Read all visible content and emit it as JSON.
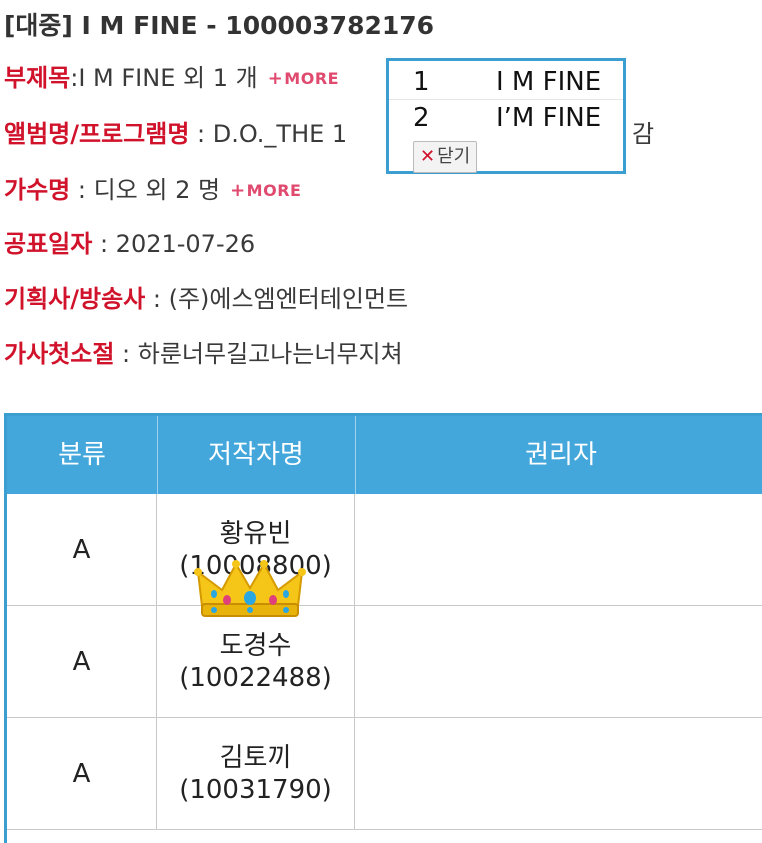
{
  "header": {
    "title": "[대중] I M FINE - 100003782176"
  },
  "info": {
    "subtitle": {
      "label": "부제목",
      "value": ":I M FINE 외 1 개",
      "more": "MORE"
    },
    "album": {
      "label": "앨범명/프로그램명",
      "value": " : D.O._THE 1",
      "tail": "감"
    },
    "artist": {
      "label": "가수명",
      "value": " : 디오 외 2 명",
      "more": "MORE"
    },
    "release_date": {
      "label": "공표일자",
      "value": " : 2021-07-26"
    },
    "company": {
      "label": "기획사/방송사",
      "value": " : (주)에스엠엔터테인먼트"
    },
    "first_lyric": {
      "label": "가사첫소절",
      "value": " : 하룬너무길고나는너무지쳐"
    }
  },
  "popup": {
    "items": [
      {
        "num": "1",
        "name": "I M FINE"
      },
      {
        "num": "2",
        "name": "I’M FINE"
      }
    ],
    "close_x": "✕",
    "close_label": "닫기"
  },
  "table": {
    "headers": [
      "분류",
      "저작자명",
      "권리자"
    ],
    "rows": [
      {
        "category": "A",
        "author": "황유빈(10008800)",
        "holder": ""
      },
      {
        "category": "A",
        "author": "도경수(10022488)",
        "holder": ""
      },
      {
        "category": "A",
        "author": "김토끼(10031790)",
        "holder": ""
      }
    ]
  },
  "colors": {
    "label_red": "#d0122b",
    "table_header": "#43a7dc",
    "border_blue": "#3a9ed0",
    "more_pink": "#e04a6e"
  },
  "icons": {
    "more": "plus-icon",
    "close": "close-icon",
    "crown": "crown-emoji"
  }
}
